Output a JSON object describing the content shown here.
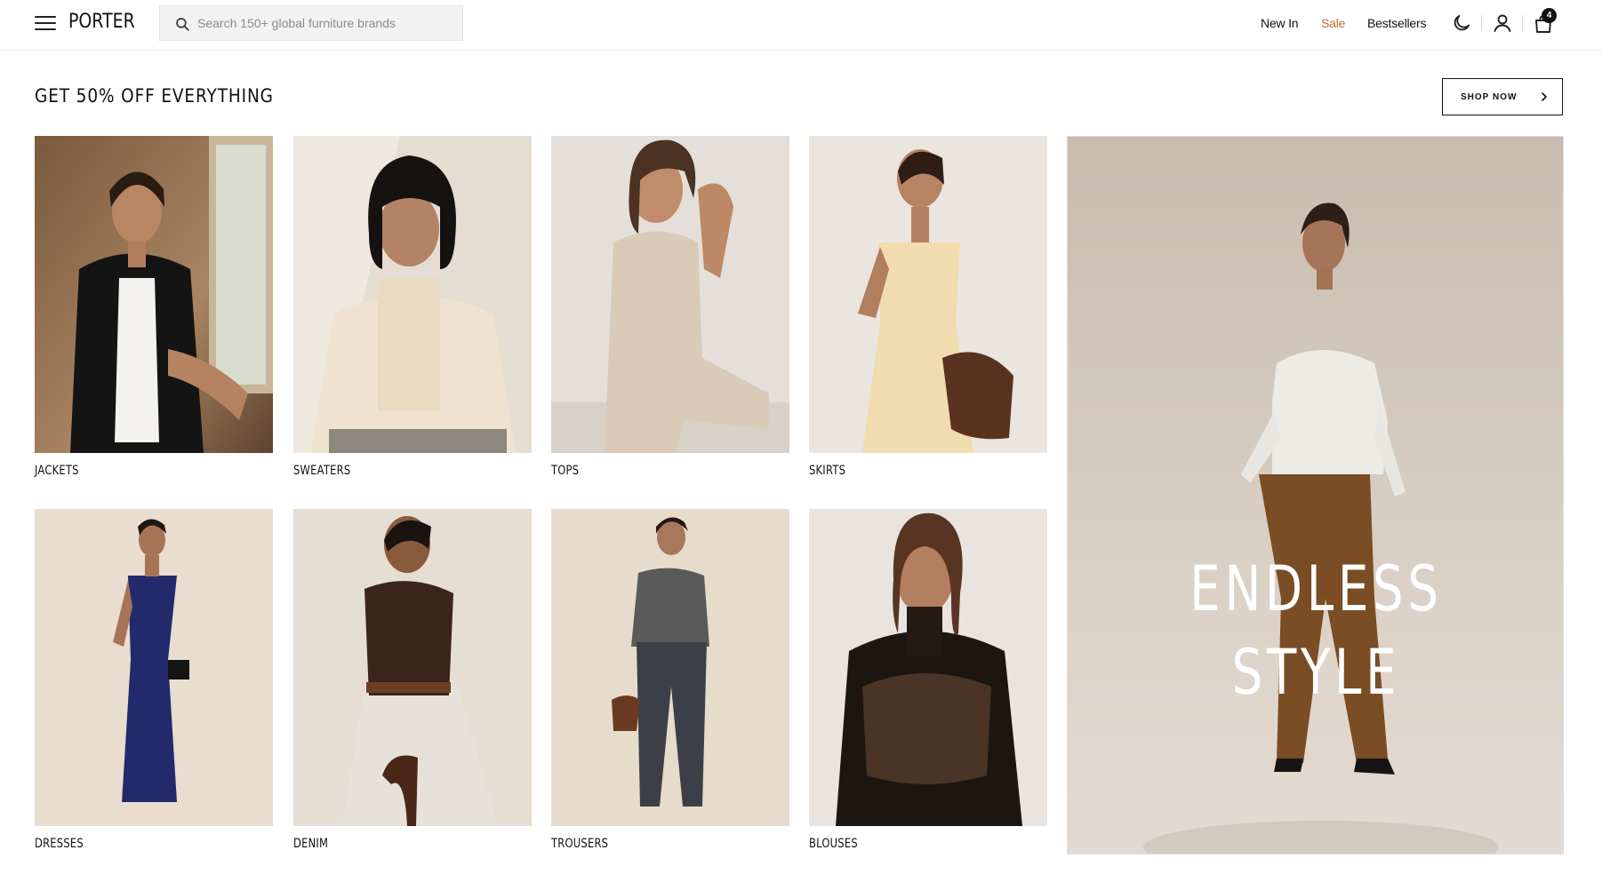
{
  "header": {
    "logo": "PORTER",
    "search": {
      "placeholder": "Search 150+ global furniture brands",
      "value": ""
    },
    "nav": [
      {
        "label": "New In"
      },
      {
        "label": "Sale",
        "color": "#c8692b"
      },
      {
        "label": "Bestsellers"
      }
    ],
    "icons": [
      "menu-icon",
      "search-icon",
      "moon-icon",
      "user-icon",
      "shopping-bag-icon"
    ],
    "cart_count": "4"
  },
  "promo": {
    "title": "GET 50% OFF EVERYTHING",
    "button_label": "SHOP NOW"
  },
  "categories": [
    {
      "label": "JACKETS"
    },
    {
      "label": "SWEATERS"
    },
    {
      "label": "TOPS"
    },
    {
      "label": "SKIRTS"
    },
    {
      "label": "DRESSES"
    },
    {
      "label": "DENIM"
    },
    {
      "label": "TROUSERS"
    },
    {
      "label": "BLOUSES"
    }
  ],
  "hero": {
    "line1": "ENDLESS",
    "line2": "STYLE"
  },
  "colors": {
    "accent_sale": "#c8692b",
    "text": "#111111",
    "background": "#ffffff"
  }
}
